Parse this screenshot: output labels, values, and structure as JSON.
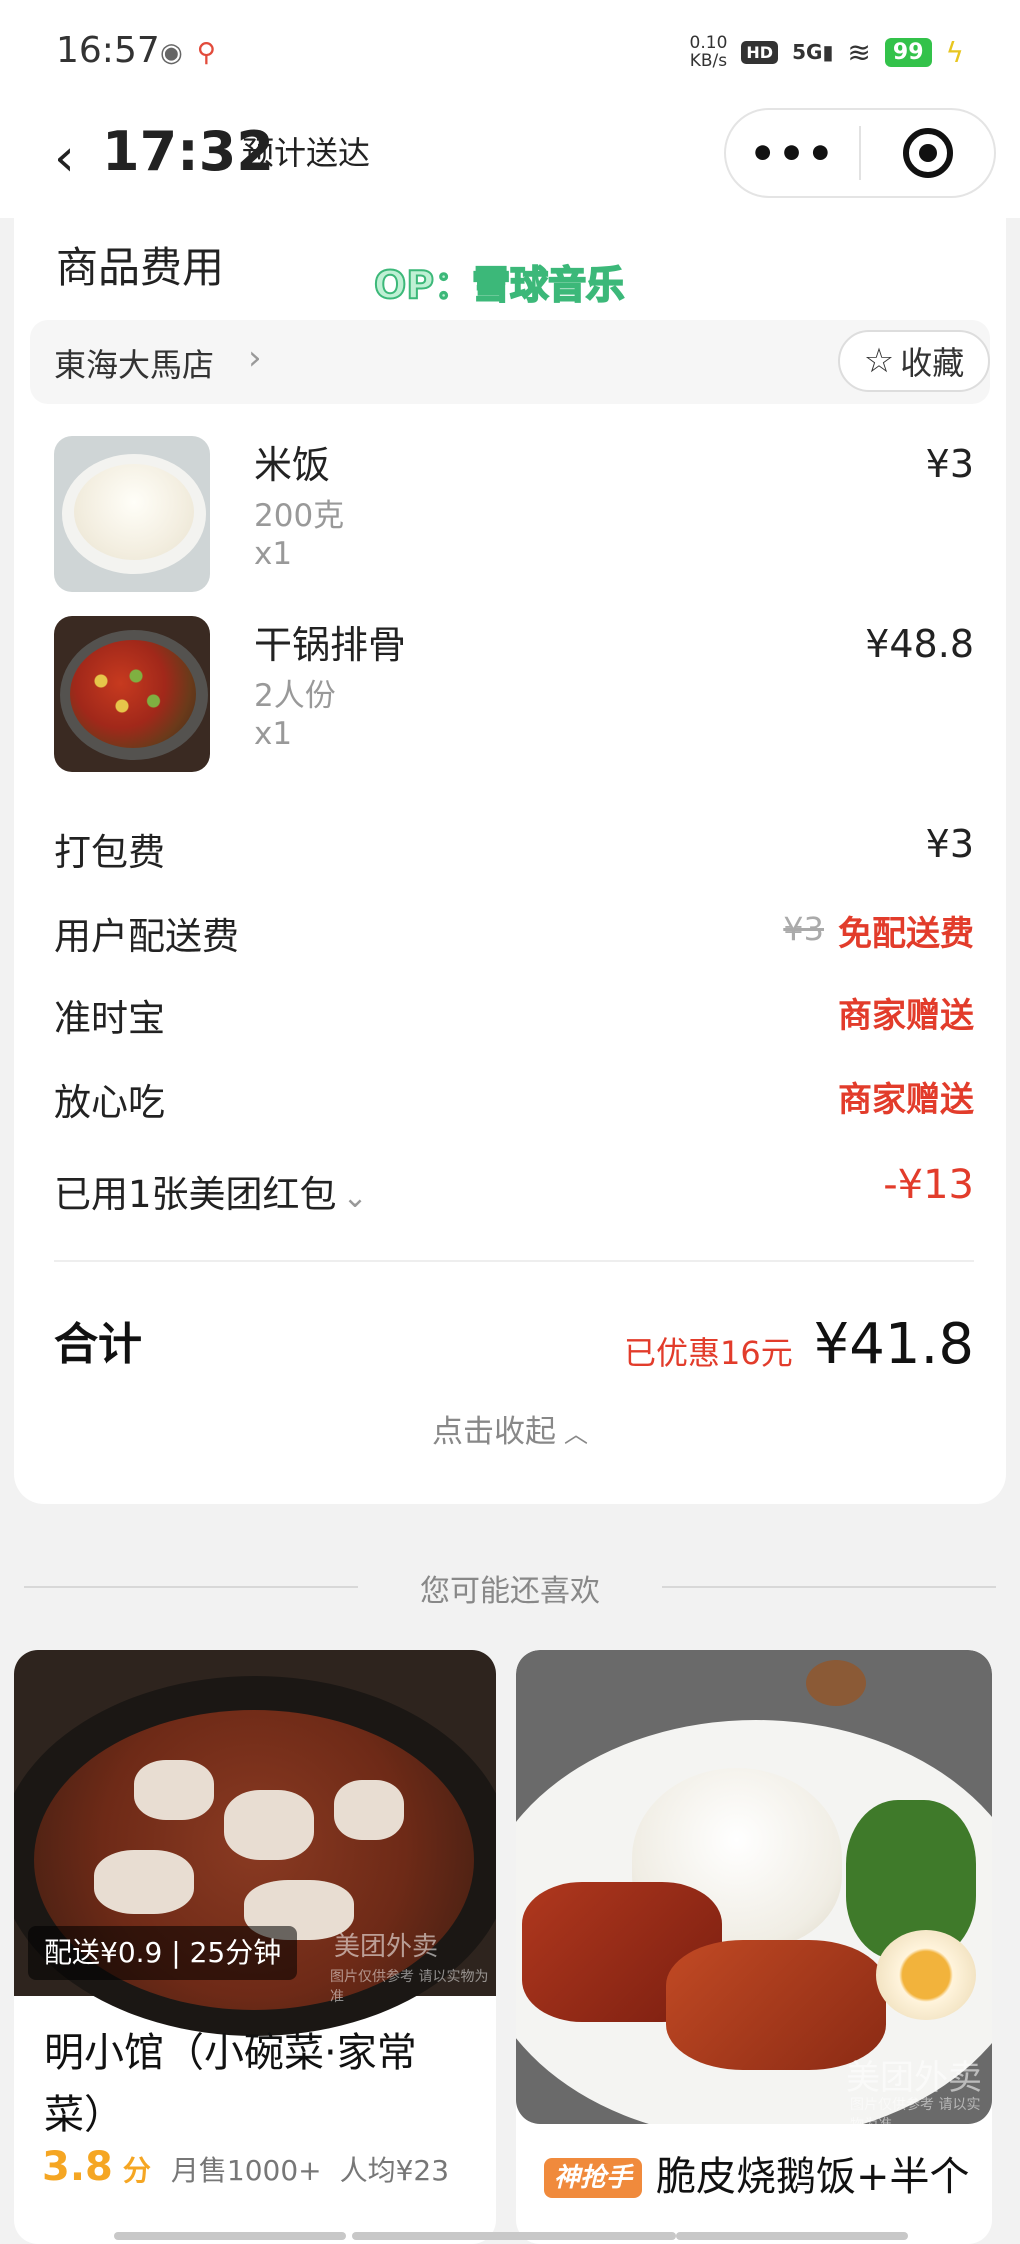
{
  "status_bar": {
    "time": "16:57",
    "net_speed_value": "0.10",
    "net_speed_unit": "KB/s",
    "hd": "HD",
    "signal": "5G",
    "battery": "99"
  },
  "header": {
    "eta_time": "17:32",
    "eta_label": "预计送达"
  },
  "order": {
    "section_title": "商品费用",
    "watermark": "OP：雪球音乐",
    "store_name": "東海大馬店",
    "fav_label": "收藏",
    "items": [
      {
        "name": "米饭",
        "spec": "200克",
        "qty": "x1",
        "price": "¥3"
      },
      {
        "name": "干锅排骨",
        "spec": "2人份",
        "qty": "x1",
        "price": "¥48.8"
      }
    ],
    "fees": {
      "packing_label": "打包费",
      "packing_value": "¥3",
      "delivery_label": "用户配送费",
      "delivery_original": "¥3",
      "delivery_value": "免配送费",
      "ontime_label": "准时宝",
      "ontime_value": "商家赠送",
      "safe_label": "放心吃",
      "safe_value": "商家赠送",
      "coupon_label": "已用1张美团红包",
      "coupon_value": "-¥13"
    },
    "total": {
      "label": "合计",
      "saved": "已优惠16元",
      "amount": "¥41.8"
    },
    "collapse_label": "点击收起"
  },
  "recommend": {
    "title": "您可能还喜欢",
    "cards": [
      {
        "delivery": "配送¥0.9 | 25分钟",
        "name": "明小馆（小碗菜·家常菜）",
        "score": "3.8",
        "score_unit": "分",
        "sales": "月售1000+",
        "avg": "人均¥23",
        "watermark": "美团外卖",
        "watermark_sub": "图片仅供参考 请以实物为准"
      },
      {
        "badge": "神抢手",
        "name": "脆皮烧鹅饭+半个卤蛋+两个青菜+米饭",
        "watermark": "美团外卖",
        "watermark_sub": "图片仅供参考 请以实物为准"
      }
    ]
  },
  "colors": {
    "accent_red": "#e23c2b",
    "rating_orange": "#f5a623",
    "watermark_green": "#3cb879"
  }
}
